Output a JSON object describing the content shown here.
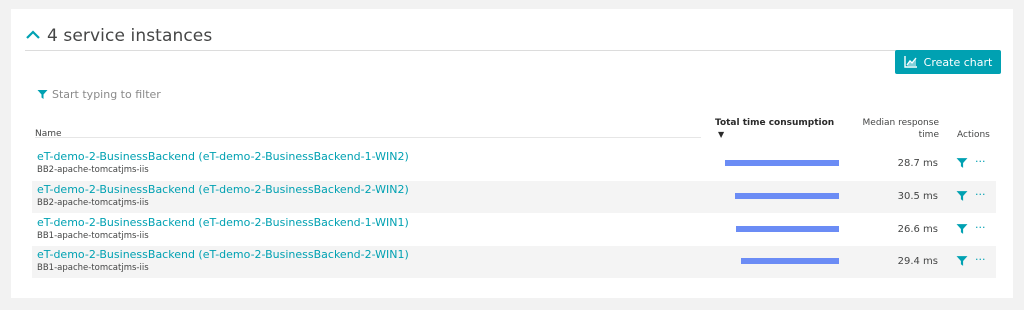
{
  "section": {
    "title": "4 service instances"
  },
  "toolbar": {
    "create_chart_label": "Create chart"
  },
  "filter": {
    "placeholder": "Start typing to filter"
  },
  "table": {
    "headers": {
      "name": "Name",
      "total_time": "Total time consumption",
      "sort_indicator": "▼",
      "median": "Median response time",
      "actions": "Actions"
    },
    "rows": [
      {
        "name": "eT-demo-2-BusinessBackend (eT-demo-2-BusinessBackend-1-WIN2)",
        "sub": "BB2-apache-tomcatjms-iis",
        "median": "28.7 ms",
        "bar_share": 1.0
      },
      {
        "name": "eT-demo-2-BusinessBackend (eT-demo-2-BusinessBackend-2-WIN2)",
        "sub": "BB2-apache-tomcatjms-iis",
        "median": "30.5 ms",
        "bar_share": 0.91
      },
      {
        "name": "eT-demo-2-BusinessBackend (eT-demo-2-BusinessBackend-1-WIN1)",
        "sub": "BB1-apache-tomcatjms-iis",
        "median": "26.6 ms",
        "bar_share": 0.9
      },
      {
        "name": "eT-demo-2-BusinessBackend (eT-demo-2-BusinessBackend-2-WIN1)",
        "sub": "BB1-apache-tomcatjms-iis",
        "median": "29.4 ms",
        "bar_share": 0.86
      }
    ],
    "more_label": "···"
  },
  "colors": {
    "accent": "#00a1b2",
    "bar": "#6b8cf5",
    "row_alt": "#f4f4f4"
  },
  "icons": {
    "collapse": "chevron-up-icon",
    "filter": "filter-icon",
    "chart": "chart-icon",
    "more": "more-icon"
  }
}
